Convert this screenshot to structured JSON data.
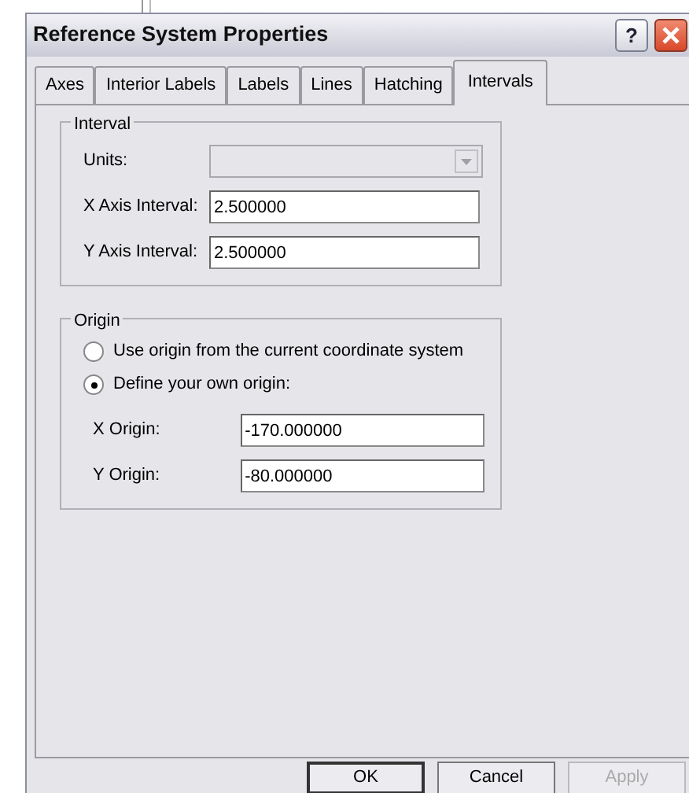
{
  "window": {
    "title": "Reference System Properties",
    "help": "?"
  },
  "tabs": [
    {
      "label": "Axes",
      "selected": false
    },
    {
      "label": "Interior Labels",
      "selected": false
    },
    {
      "label": "Labels",
      "selected": false
    },
    {
      "label": "Lines",
      "selected": false
    },
    {
      "label": "Hatching",
      "selected": false
    },
    {
      "label": "Intervals",
      "selected": true
    }
  ],
  "interval": {
    "title": "Interval",
    "units": {
      "label": "Units:",
      "disabled": true
    },
    "fields": [
      {
        "label": "X Axis Interval:",
        "value": "2.500000"
      },
      {
        "label": "Y Axis Interval:",
        "value": "2.500000"
      }
    ]
  },
  "origin": {
    "title": "Origin",
    "options": [
      {
        "label": "Use origin from the current coordinate system",
        "selected": false
      },
      {
        "label": "Define your own origin:",
        "selected": true
      }
    ],
    "fields": [
      {
        "label": "X Origin:",
        "value": "-170.000000"
      },
      {
        "label": "Y Origin:",
        "value": "-80.000000"
      }
    ]
  },
  "buttons": [
    {
      "label": "OK",
      "default": true,
      "disabled": false
    },
    {
      "label": "Cancel",
      "default": false,
      "disabled": false
    },
    {
      "label": "Apply",
      "default": false,
      "disabled": true
    }
  ]
}
